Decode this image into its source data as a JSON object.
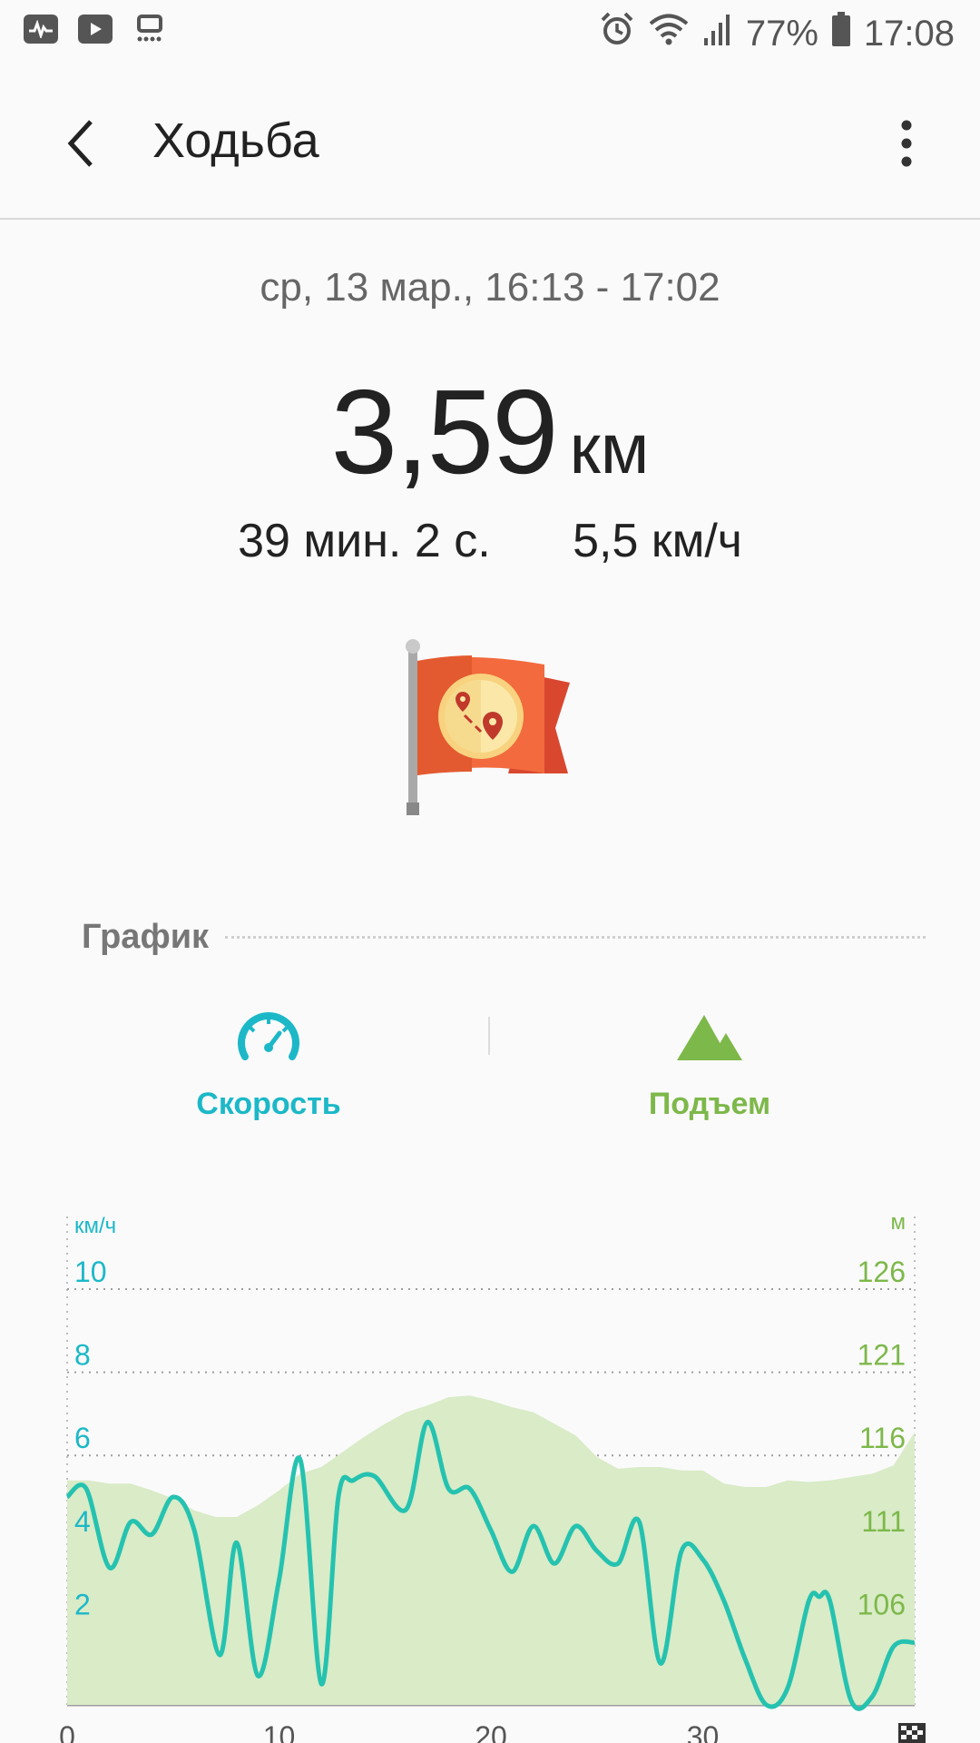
{
  "status_bar": {
    "battery_percent": "77%",
    "time": "17:08",
    "icons": [
      "health-icon",
      "youtube-icon",
      "game-icon",
      "alarm-icon",
      "wifi-icon",
      "signal-icon",
      "battery-icon"
    ]
  },
  "app_bar": {
    "title": "Ходьба"
  },
  "summary": {
    "date_range": "ср, 13 мар., 16:13 - 17:02",
    "distance_value": "3,59",
    "distance_unit": "км",
    "duration": "39 мин. 2 с.",
    "avg_speed": "5,5 км/ч"
  },
  "graph_section": {
    "title": "График",
    "tabs": [
      {
        "label": "Скорость",
        "icon": "speedometer-icon",
        "color": "#1cb8c8"
      },
      {
        "label": "Подъем",
        "icon": "mountain-icon",
        "color": "#7db84a"
      }
    ]
  },
  "chart_data": {
    "type": "line",
    "y_left_label": "км/ч",
    "y_right_label": "м",
    "y_left_ticks": [
      "10",
      "8",
      "6",
      "4",
      "2"
    ],
    "y_right_ticks": [
      "126",
      "121",
      "116",
      "111",
      "106"
    ],
    "x_ticks": [
      "0",
      "10",
      "20",
      "30"
    ],
    "ylim_left": [
      0,
      10
    ],
    "ylim_right": [
      101,
      126
    ],
    "xlim": [
      0,
      40
    ],
    "grid": true,
    "colors": {
      "speed": "#25c2b0",
      "elevation_fill": "#d9ebc7",
      "left_axis": "#1cb8c8",
      "right_axis": "#7db84a"
    },
    "series": [
      {
        "name": "Скорость",
        "x": [
          0,
          0.9,
          2,
          3,
          4,
          5,
          6,
          7.2,
          8,
          9,
          10,
          11,
          12,
          12.8,
          13.5,
          14.5,
          16,
          17,
          18,
          19,
          20,
          21,
          22,
          23,
          24,
          25,
          26,
          27,
          28,
          29,
          30,
          31,
          32,
          33,
          34,
          35,
          35.5,
          36,
          37,
          38,
          39,
          40
        ],
        "values": [
          5.0,
          5.2,
          3.3,
          4.4,
          4.1,
          5.0,
          4.2,
          1.2,
          3.9,
          0.7,
          3.0,
          5.9,
          0.5,
          5.0,
          5.4,
          5.5,
          4.7,
          6.8,
          5.2,
          5.2,
          4.2,
          3.2,
          4.3,
          3.4,
          4.3,
          3.7,
          3.4,
          4.4,
          1.0,
          3.7,
          3.5,
          2.5,
          1.1,
          0.0,
          0.4,
          2.5,
          2.6,
          2.5,
          0.1,
          0.2,
          1.4,
          1.5
        ]
      },
      {
        "name": "Подъем",
        "x": [
          0,
          1,
          2,
          3,
          4,
          5,
          6,
          7,
          8,
          9,
          10,
          11,
          12,
          13,
          14,
          15,
          16,
          17,
          18,
          19,
          20,
          21,
          22,
          23,
          24,
          25,
          26,
          27,
          28,
          29,
          30,
          31,
          32,
          33,
          34,
          35,
          36,
          37,
          38,
          39,
          40
        ],
        "values": [
          114.5,
          114.5,
          114.3,
          114.3,
          113.9,
          113.4,
          112.7,
          112.3,
          112.3,
          113.0,
          113.9,
          114.9,
          115.3,
          116.2,
          117.1,
          117.9,
          118.6,
          119.0,
          119.5,
          119.6,
          119.3,
          118.9,
          118.6,
          117.9,
          117.2,
          115.9,
          115.2,
          115.3,
          115.3,
          115.1,
          115.1,
          114.3,
          114.1,
          114.1,
          114.5,
          114.4,
          114.5,
          114.7,
          114.9,
          115.4,
          117.4
        ]
      }
    ]
  }
}
